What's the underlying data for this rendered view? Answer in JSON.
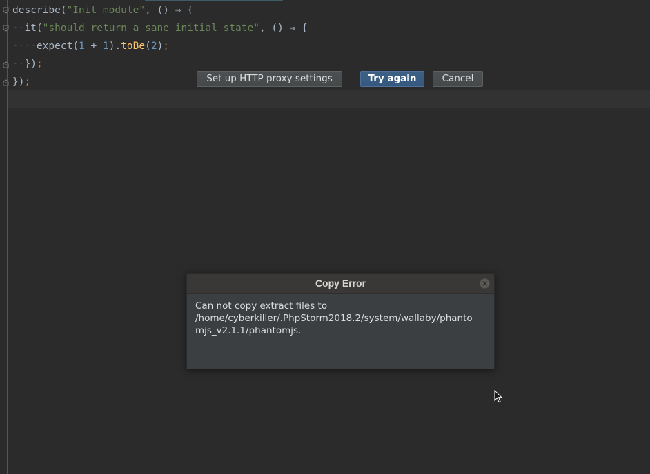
{
  "editor": {
    "lines": [
      {
        "parts": [
          "describe(",
          "\"Init module\"",
          ", () ⇒ {"
        ]
      },
      {
        "parts": [
          "it(",
          "\"should return a sane initial state\"",
          ", () ⇒ {"
        ]
      },
      {
        "parts": [
          "expect(",
          "1",
          " + ",
          "1",
          ").",
          "toBe",
          "(",
          "2",
          ")",
          ";"
        ]
      },
      {
        "parts": [
          "})",
          ";"
        ]
      },
      {
        "parts": [
          "})",
          ";"
        ]
      }
    ]
  },
  "dialog": {
    "title": "Copy Error",
    "message_lines": [
      "Can not copy extract files to",
      "/home/cyberkiller/.PhpStorm2018.2/system/wallaby/phanto",
      "mjs_v2.1.1/phantomjs."
    ],
    "buttons": {
      "proxy": "Set up HTTP proxy settings",
      "try_again": "Try again",
      "cancel": "Cancel"
    }
  },
  "icons": {
    "close": "close-icon",
    "fold": "fold-marker-icon",
    "cursor": "mouse-pointer-icon"
  },
  "colors": {
    "editor_bg": "#2b2b2b",
    "string": "#6a8759",
    "number": "#6897bb",
    "function": "#ffc66d",
    "keyword": "#cc7832",
    "text": "#a9b7c6",
    "primary_button": "#365880"
  }
}
